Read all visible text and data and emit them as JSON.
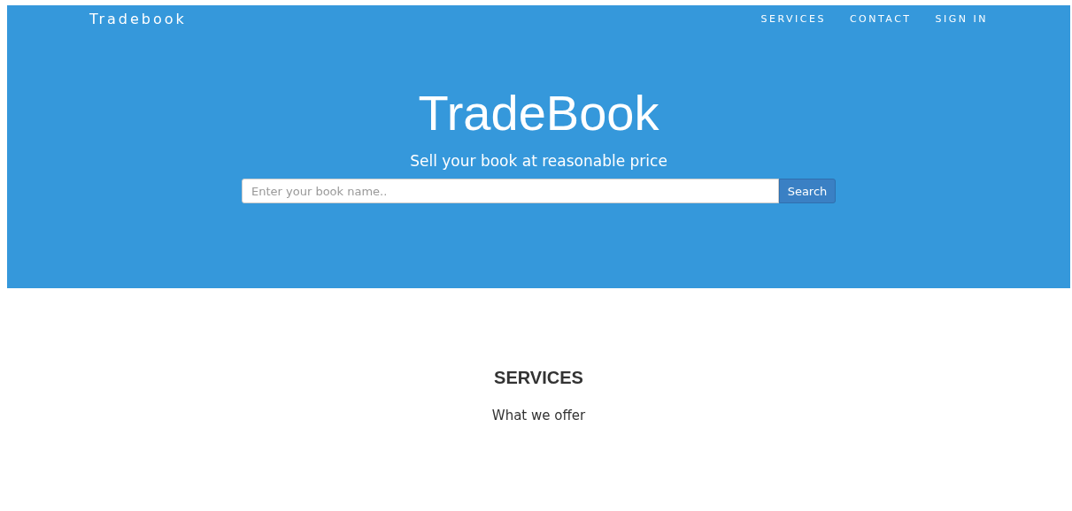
{
  "navbar": {
    "brand": "Tradebook",
    "links": [
      {
        "label": "SERVICES"
      },
      {
        "label": "CONTACT"
      },
      {
        "label": "SIGN IN"
      }
    ]
  },
  "hero": {
    "title": "TradeBook",
    "subtitle": "Sell your book at reasonable price",
    "search": {
      "placeholder": "Enter your book name..",
      "button": "Search"
    }
  },
  "services": {
    "heading": "SERVICES",
    "subheading": "What we offer"
  }
}
